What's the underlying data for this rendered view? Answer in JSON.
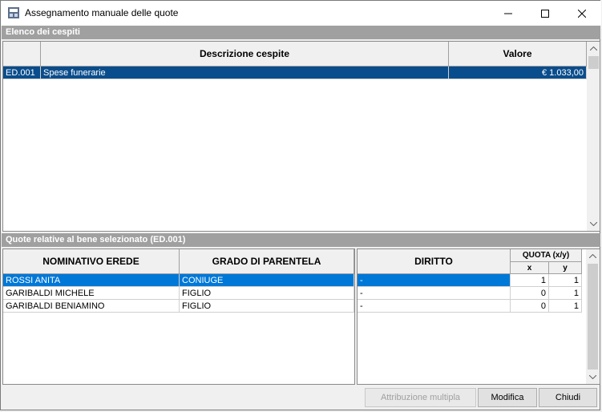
{
  "window": {
    "title": "Assegnamento manuale delle quote"
  },
  "assets": {
    "section_title": "Elenco dei cespiti",
    "headers": {
      "code": "",
      "description": "Descrizione cespite",
      "value": "Valore"
    },
    "rows": [
      {
        "code": "ED.001",
        "description": "Spese funerarie",
        "value": "€ 1.033,00"
      }
    ]
  },
  "shares": {
    "section_title": "Quote relative al bene selezionato (ED.001)",
    "headers": {
      "heir": "NOMINATIVO EREDE",
      "relationship": "GRADO DI PARENTELA",
      "right": "DIRITTO",
      "quota": "QUOTA (x/y)",
      "x": "x",
      "y": "y"
    },
    "rows": [
      {
        "heir": "ROSSI ANITA",
        "relationship": "CONIUGE",
        "right": "-",
        "x": "1",
        "y": "1"
      },
      {
        "heir": "GARIBALDI MICHELE",
        "relationship": "FIGLIO",
        "right": "-",
        "x": "0",
        "y": "1"
      },
      {
        "heir": "GARIBALDI BENIAMINO",
        "relationship": "FIGLIO",
        "right": "-",
        "x": "0",
        "y": "1"
      }
    ]
  },
  "buttons": {
    "multiple": "Attribuzione multipla",
    "edit": "Modifica",
    "close": "Chiudi"
  }
}
